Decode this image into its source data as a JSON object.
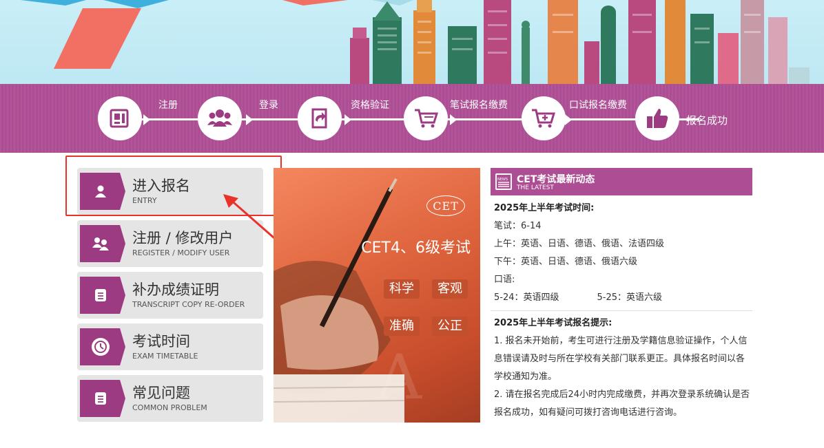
{
  "steps": [
    {
      "label": "注册",
      "icon": "register-card-icon"
    },
    {
      "label": "登录",
      "icon": "users-group-icon"
    },
    {
      "label": "资格验证",
      "icon": "verify-arrow-icon"
    },
    {
      "label": "笔试报名缴费",
      "icon": "cart-icon"
    },
    {
      "label": "口试报名缴费",
      "icon": "cart-plus-icon"
    },
    {
      "label": "报名成功",
      "icon": "thumbs-up-icon"
    }
  ],
  "menu": [
    {
      "title": "进入报名",
      "sub": "ENTRY",
      "icon": "user-icon"
    },
    {
      "title": "注册 / 修改用户",
      "sub": "REGISTER / MODIFY USER",
      "icon": "users-icon"
    },
    {
      "title": "补办成绩证明",
      "sub": "TRANSCRIPT COPY RE-ORDER",
      "icon": "document-icon"
    },
    {
      "title": "考试时间",
      "sub": "EXAM TIMETABLE",
      "icon": "clock-icon"
    },
    {
      "title": "常见问题",
      "sub": "COMMON PROBLEM",
      "icon": "faq-document-icon"
    }
  ],
  "banner": {
    "logo": "CET",
    "title": "CET4、6级考试",
    "tags": [
      "科学",
      "客观",
      "准确",
      "公正"
    ]
  },
  "news": {
    "title": "CET考试最新动态",
    "subtitle": "THE LATEST",
    "icon_text": "NEWS",
    "section1_heading": "2025年上半年考试时间:",
    "written": "笔试：6-14",
    "morning": "上午：英语、日语、德语、俄语、法语四级",
    "afternoon": "下午：英语、日语、德语、俄语六级",
    "oral": "口语:",
    "oral_dates_a": "5-24：英语四级",
    "oral_dates_b": "5-25：英语六级",
    "section2_heading": "2025年上半年考试报名提示:",
    "tip1": "1. 报名未开始前，考生可进行注册及学籍信息验证操作，个人信息错误请及时与所在学校有关部门联系更正。具体报名时间以各学校通知为准。",
    "tip2": "2. 请在报名完成后24小时内完成缴费，并再次登录系统确认是否报名成功，如有疑问可拨打咨询电话进行咨询。"
  },
  "colors": {
    "brand_purple": "#ad4d93",
    "menu_badge": "#9c3b82",
    "highlight_red": "#e8322a",
    "banner_orange": "#e0663f"
  }
}
